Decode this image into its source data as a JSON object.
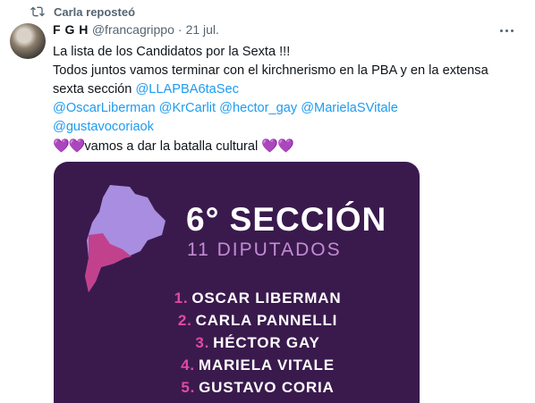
{
  "repost": {
    "label": "Carla reposteó",
    "icon": "repost-icon"
  },
  "tweet": {
    "author_name": "F G H",
    "handle": "@francagrippo",
    "separator": "·",
    "date": "21 jul.",
    "lines": [
      "La lista de los Candidatos por la Sexta !!!",
      "Todos juntos vamos terminar con el kirchnerismo en la PBA y en la extensa",
      "sexta sección"
    ],
    "hashtag": "@LLAPBA6taSec",
    "mentions": "@OscarLiberman @KrCarlit @hector_gay @MarielaSVitale",
    "mention_last": "@gustavocoriaok",
    "closing_hearts_left": "💜💜",
    "closing_text": "vamos a dar la batalla cultural",
    "closing_hearts_right": "💜💜"
  },
  "card": {
    "title": "6° SECCIÓN",
    "subtitle": "11 DIPUTADOS",
    "colors": {
      "background": "#3a1a4d",
      "accent": "#e04aa4",
      "map_light": "#a98de0",
      "map_magenta": "#c2418d"
    },
    "candidates": [
      {
        "num": "1.",
        "name": "OSCAR LIBERMAN"
      },
      {
        "num": "2.",
        "name": "CARLA PANNELLI"
      },
      {
        "num": "3.",
        "name": "HÉCTOR GAY"
      },
      {
        "num": "4.",
        "name": "MARIELA VITALE"
      },
      {
        "num": "5.",
        "name": "GUSTAVO CORIA"
      }
    ]
  },
  "icons": {
    "more": "more-options-icon"
  }
}
